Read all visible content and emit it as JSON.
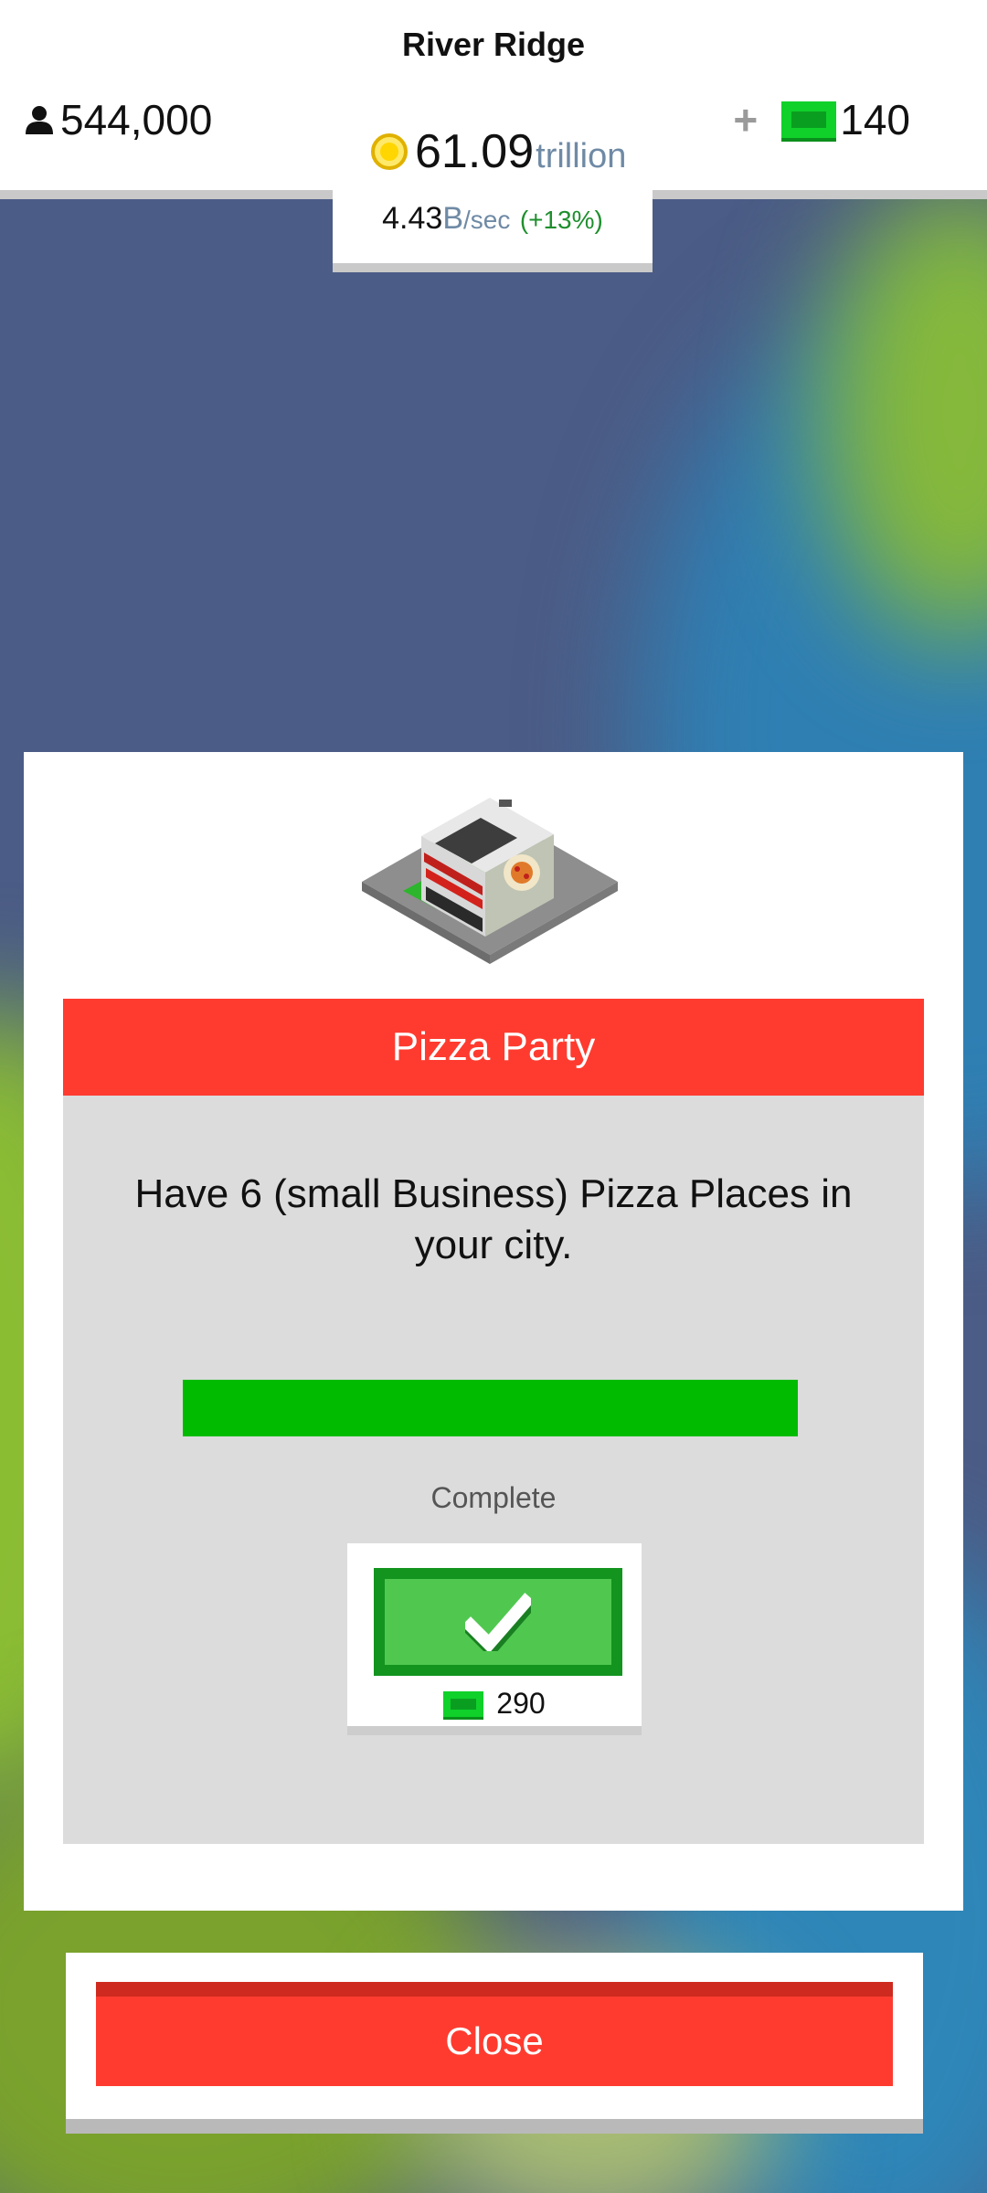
{
  "hud": {
    "city_name": "River Ridge",
    "population": "544,000",
    "coins_value": "61.09",
    "coins_unit": "trillion",
    "rate_value": "4.43",
    "rate_unit": "B",
    "rate_suffix": "/sec",
    "rate_change": "(+13%)",
    "gems_plus": "+",
    "gems": "140"
  },
  "achievement": {
    "title": "Pizza Party",
    "description": "Have 6 (small Business) Pizza Places in your city.",
    "progress_fraction": 1.0,
    "status": "Complete",
    "reward_amount": "290",
    "reward_icon": "cash-icon"
  },
  "footer": {
    "close_label": "Close"
  },
  "colors": {
    "title_bar": "#ff3b2f",
    "progress_fill": "#00bb00",
    "claim_button": "#50c850",
    "close_button": "#ff3b2f"
  }
}
